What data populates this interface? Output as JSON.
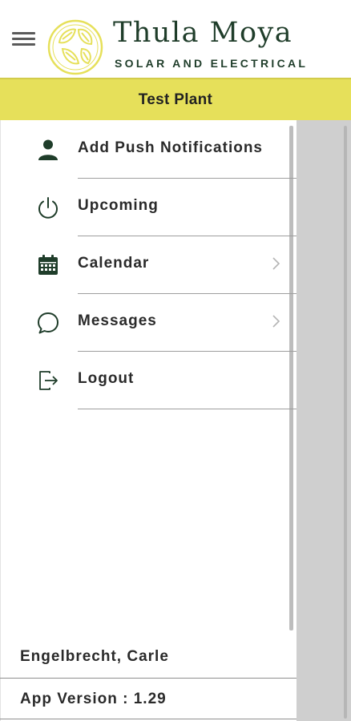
{
  "header": {
    "brand_name": "Thula Moya",
    "brand_tagline": "SOLAR AND ELECTRICAL",
    "menu_icon": "hamburger-menu-icon",
    "logo_icon": "leaf-logo-icon"
  },
  "plant": {
    "name": "Test Plant"
  },
  "menu": {
    "items": [
      {
        "label": "Add Push Notifications",
        "icon": "person-icon",
        "has_chevron": false
      },
      {
        "label": "Upcoming",
        "icon": "power-icon",
        "has_chevron": false
      },
      {
        "label": "Calendar",
        "icon": "calendar-icon",
        "has_chevron": true
      },
      {
        "label": "Messages",
        "icon": "chat-bubble-icon",
        "has_chevron": true
      },
      {
        "label": "Logout",
        "icon": "logout-icon",
        "has_chevron": false
      }
    ]
  },
  "footer": {
    "user_name": "Engelbrecht, Carle",
    "app_version": "App Version : 1.29"
  },
  "colors": {
    "brand_green": "#1f3d2a",
    "plant_bar": "#e6e05a",
    "overlay": "#cfcfcf"
  }
}
